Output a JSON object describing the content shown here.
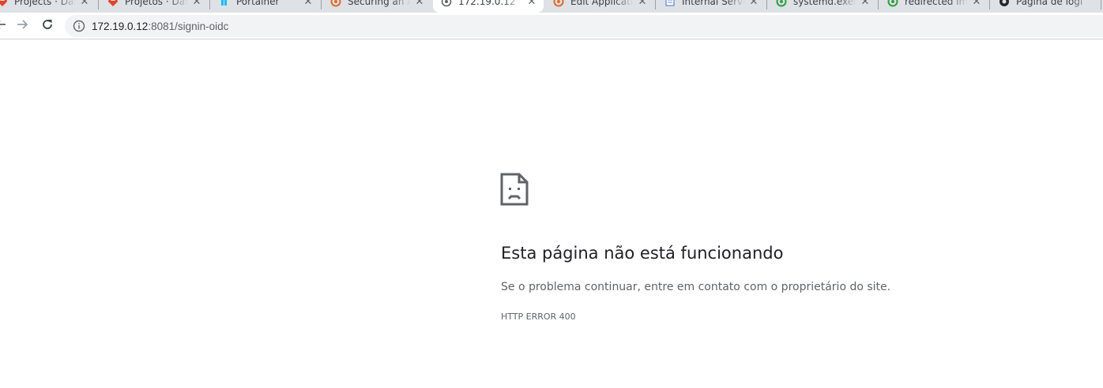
{
  "browser": {
    "tabs": [
      {
        "title": "Projects · Das",
        "favicon": "gitlab-icon",
        "active": false
      },
      {
        "title": "Projetos · Das",
        "favicon": "gitlab-icon",
        "active": false
      },
      {
        "title": "Portainer",
        "favicon": "portainer-icon",
        "active": false
      },
      {
        "title": "Securing an A",
        "favicon": "site-icon",
        "active": false
      },
      {
        "title": "172.19.0.12",
        "favicon": "page-icon",
        "active": true
      },
      {
        "title": "Edit Applicatio",
        "favicon": "site-icon",
        "active": false
      },
      {
        "title": "Internal Serve",
        "favicon": "document-icon",
        "active": false
      },
      {
        "title": "systemd.exec",
        "favicon": "green-circle-icon",
        "active": false
      },
      {
        "title": "redirected im",
        "favicon": "green-circle-icon",
        "active": false
      },
      {
        "title": "Página de logi",
        "favicon": "github-icon",
        "active": false
      }
    ],
    "close_glyph": "✕",
    "url_host": "172.19.0.12",
    "url_rest": ":8081/signin-oidc"
  },
  "error": {
    "icon": "sad-page-icon",
    "heading": "Esta página não está funcionando",
    "message": "Se o problema continuar, entre em contato com o proprietário do site.",
    "code": "HTTP ERROR 400"
  },
  "colors": {
    "tabstrip": "#dee1e6",
    "omnibox": "#f1f3f4",
    "heading": "#202124",
    "text": "#5f6368"
  }
}
